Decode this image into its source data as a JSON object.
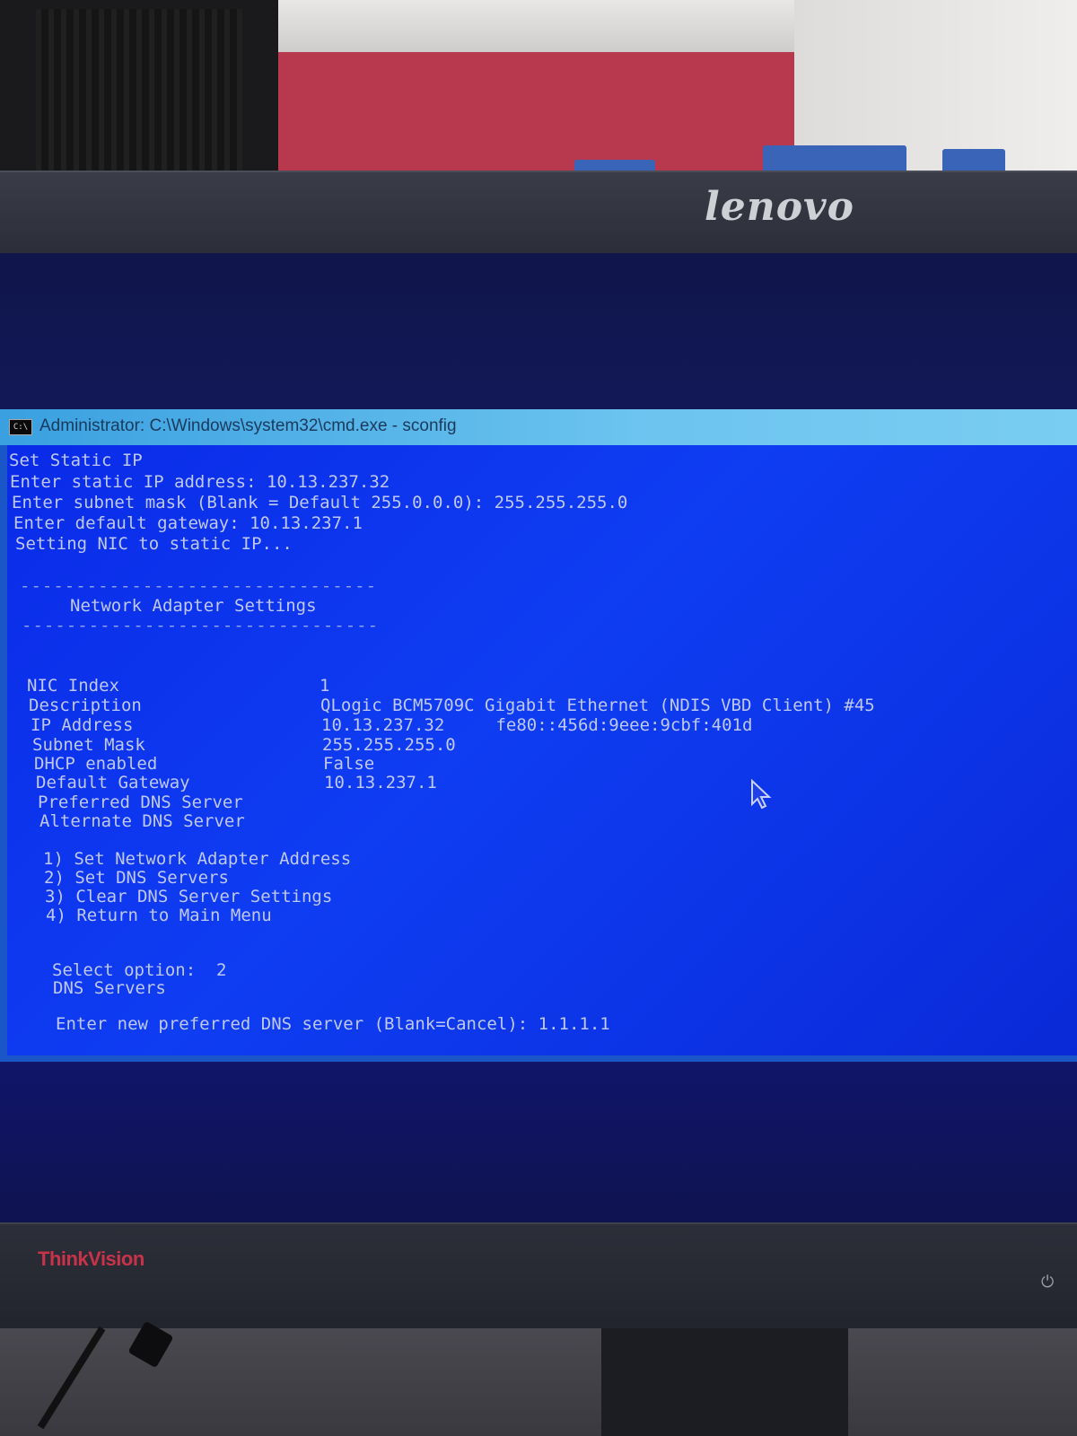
{
  "monitor": {
    "brand_top": "lenovo",
    "brand_bottom": "ThinkVision"
  },
  "window": {
    "icon_text": "C:\\",
    "title": "Administrator: C:\\Windows\\system32\\cmd.exe - sconfig"
  },
  "console": {
    "header_lines": [
      "Set Static IP",
      "Enter static IP address: 10.13.237.32",
      "Enter subnet mask (Blank = Default 255.0.0.0): 255.255.255.0",
      "Enter default gateway: 10.13.237.1",
      "Setting NIC to static IP..."
    ],
    "separator": "--------------------------------",
    "section_title": "Network Adapter Settings",
    "settings": [
      {
        "label": "NIC Index",
        "value": "1"
      },
      {
        "label": "Description",
        "value": "QLogic BCM5709C Gigabit Ethernet (NDIS VBD Client) #45"
      },
      {
        "label": "IP Address",
        "value": "10.13.237.32     fe80::456d:9eee:9cbf:401d"
      },
      {
        "label": "Subnet Mask",
        "value": "255.255.255.0"
      },
      {
        "label": "DHCP enabled",
        "value": "False"
      },
      {
        "label": "Default Gateway",
        "value": "10.13.237.1"
      },
      {
        "label": "Preferred DNS Server",
        "value": ""
      },
      {
        "label": "Alternate DNS Server",
        "value": ""
      }
    ],
    "menu": [
      "1) Set Network Adapter Address",
      "2) Set DNS Servers",
      "3) Clear DNS Server Settings",
      "4) Return to Main Menu"
    ],
    "select_prompt": "Select option:  2",
    "dns_heading": "DNS Servers",
    "dns_input_prompt": "Enter new preferred DNS server (Blank=Cancel): 1.1.1.1"
  }
}
